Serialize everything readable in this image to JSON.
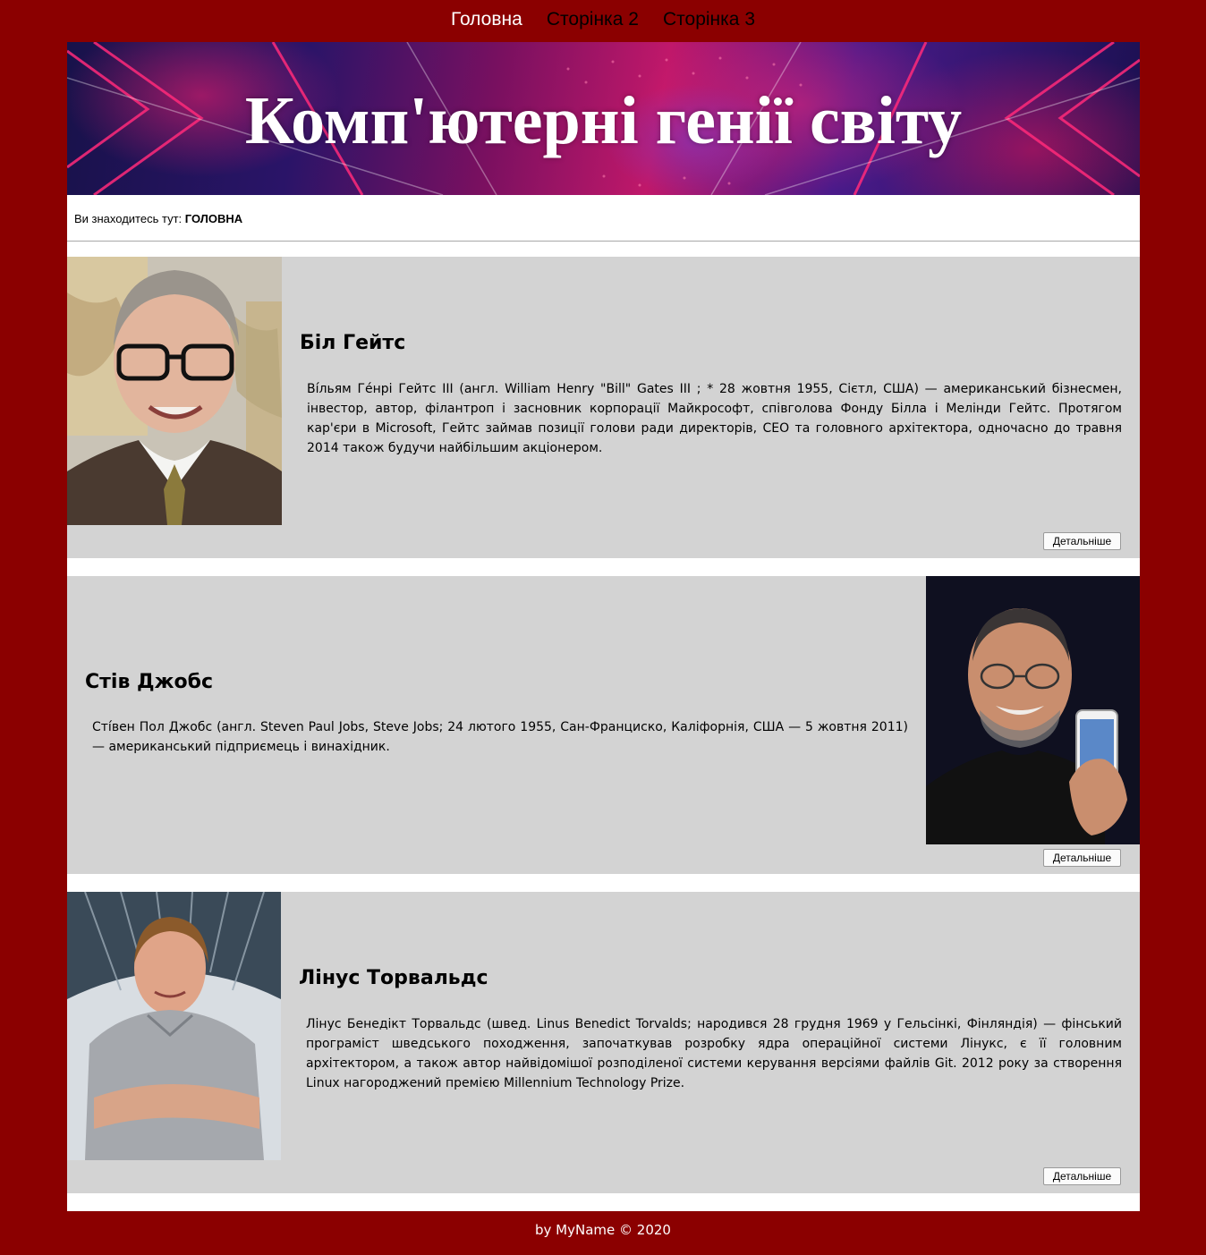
{
  "nav": {
    "items": [
      {
        "label": "Головна",
        "active": true
      },
      {
        "label": "Сторінка 2",
        "active": false
      },
      {
        "label": "Сторінка 3",
        "active": false
      }
    ]
  },
  "banner": {
    "title": "Комп'ютерні генії світу"
  },
  "breadcrumb": {
    "prefix": "Ви знаходитесь тут:",
    "current": "ГОЛОВНА"
  },
  "cards": [
    {
      "name": "Біл Гейтс",
      "description": "Ві́льям Ге́нрі Гейтс III (англ. William Henry \"Bill\" Gates III ; * 28 жовтня 1955, Сієтл, США) — американський бізнесмен, інвестор, автор, філантроп і засновник корпорації Майкрософт, співголова Фонду Білла і Мелінди Гейтс. Протягом кар'єри в Microsoft, Гейтс займав позиції голови ради директорів, CEO та головного архітектора, одночасно до травня 2014 також будучи найбільшим акціонером.",
      "button": "Детальніше",
      "photo_side": "left"
    },
    {
      "name": "Стів Джобс",
      "description": "Сті́вен Пол Джобс (англ. Steven Paul Jobs, Steve Jobs; 24 лютого 1955, Сан-Франциско, Каліфорнія, США — 5 жовтня 2011) — американський підприємець і винахідник.",
      "button": "Детальніше",
      "photo_side": "right"
    },
    {
      "name": "Лінус Торвальдс",
      "description": "Лінус Бенедікт Торвальдс (швед. Linus Benedict Torvalds; народився 28 грудня 1969 у Гельсінкі, Фінляндія) — фінський програміст шведського походження, започаткував розробку ядра операційної системи Лінукс, є її головним архітектором, а також автор найвідомішої розподіленої системи керування версіями файлів Git. 2012 року за створення Linux нагороджений премією Millennium Technology Prize.",
      "button": "Детальніше",
      "photo_side": "left"
    }
  ],
  "footer": {
    "text": "by MyName © 2020"
  },
  "colors": {
    "page_bg": "#8b0000",
    "card_bg": "#d3d3d3",
    "active_nav": "#ffffff"
  }
}
